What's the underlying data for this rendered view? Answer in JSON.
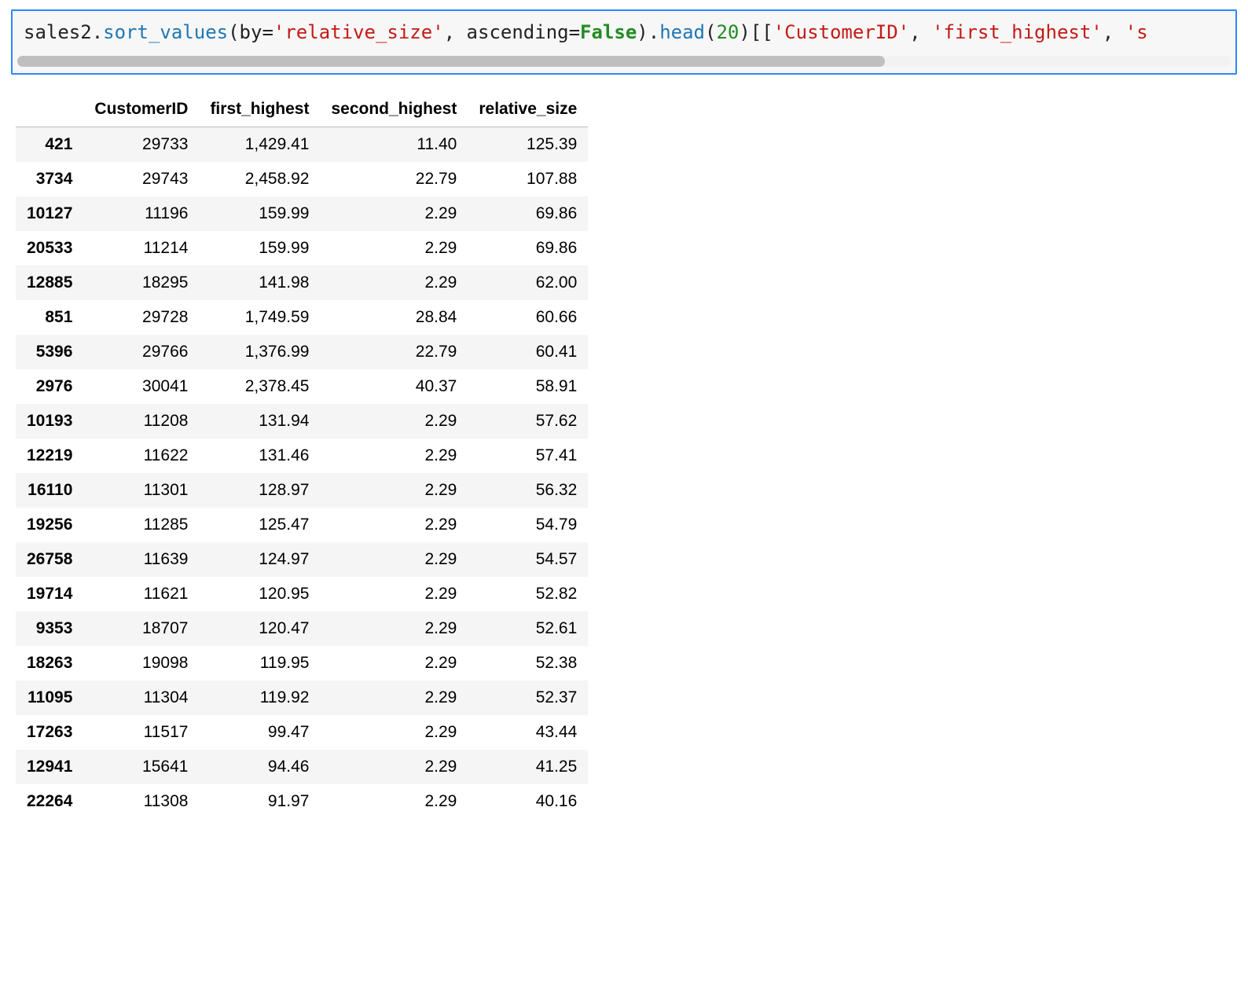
{
  "code": {
    "t1": "sales2",
    "d1": ".",
    "m1": "sort_values",
    "p1": "(by=",
    "s1": "'relative_size'",
    "p2": ", ascending=",
    "k1": "False",
    "p3": ")",
    "d2": ".",
    "m2": "head",
    "p4": "(",
    "n1": "20",
    "p5": ")[[",
    "s2": "'CustomerID'",
    "p6": ", ",
    "s3": "'first_highest'",
    "p7": ", ",
    "s4": "'s"
  },
  "table": {
    "columns": [
      "CustomerID",
      "first_highest",
      "second_highest",
      "relative_size"
    ],
    "rows": [
      {
        "idx": "421",
        "CustomerID": "29733",
        "first_highest": "1,429.41",
        "second_highest": "11.40",
        "relative_size": "125.39"
      },
      {
        "idx": "3734",
        "CustomerID": "29743",
        "first_highest": "2,458.92",
        "second_highest": "22.79",
        "relative_size": "107.88"
      },
      {
        "idx": "10127",
        "CustomerID": "11196",
        "first_highest": "159.99",
        "second_highest": "2.29",
        "relative_size": "69.86"
      },
      {
        "idx": "20533",
        "CustomerID": "11214",
        "first_highest": "159.99",
        "second_highest": "2.29",
        "relative_size": "69.86"
      },
      {
        "idx": "12885",
        "CustomerID": "18295",
        "first_highest": "141.98",
        "second_highest": "2.29",
        "relative_size": "62.00"
      },
      {
        "idx": "851",
        "CustomerID": "29728",
        "first_highest": "1,749.59",
        "second_highest": "28.84",
        "relative_size": "60.66"
      },
      {
        "idx": "5396",
        "CustomerID": "29766",
        "first_highest": "1,376.99",
        "second_highest": "22.79",
        "relative_size": "60.41"
      },
      {
        "idx": "2976",
        "CustomerID": "30041",
        "first_highest": "2,378.45",
        "second_highest": "40.37",
        "relative_size": "58.91"
      },
      {
        "idx": "10193",
        "CustomerID": "11208",
        "first_highest": "131.94",
        "second_highest": "2.29",
        "relative_size": "57.62"
      },
      {
        "idx": "12219",
        "CustomerID": "11622",
        "first_highest": "131.46",
        "second_highest": "2.29",
        "relative_size": "57.41"
      },
      {
        "idx": "16110",
        "CustomerID": "11301",
        "first_highest": "128.97",
        "second_highest": "2.29",
        "relative_size": "56.32"
      },
      {
        "idx": "19256",
        "CustomerID": "11285",
        "first_highest": "125.47",
        "second_highest": "2.29",
        "relative_size": "54.79"
      },
      {
        "idx": "26758",
        "CustomerID": "11639",
        "first_highest": "124.97",
        "second_highest": "2.29",
        "relative_size": "54.57"
      },
      {
        "idx": "19714",
        "CustomerID": "11621",
        "first_highest": "120.95",
        "second_highest": "2.29",
        "relative_size": "52.82"
      },
      {
        "idx": "9353",
        "CustomerID": "18707",
        "first_highest": "120.47",
        "second_highest": "2.29",
        "relative_size": "52.61"
      },
      {
        "idx": "18263",
        "CustomerID": "19098",
        "first_highest": "119.95",
        "second_highest": "2.29",
        "relative_size": "52.38"
      },
      {
        "idx": "11095",
        "CustomerID": "11304",
        "first_highest": "119.92",
        "second_highest": "2.29",
        "relative_size": "52.37"
      },
      {
        "idx": "17263",
        "CustomerID": "11517",
        "first_highest": "99.47",
        "second_highest": "2.29",
        "relative_size": "43.44"
      },
      {
        "idx": "12941",
        "CustomerID": "15641",
        "first_highest": "94.46",
        "second_highest": "2.29",
        "relative_size": "41.25"
      },
      {
        "idx": "22264",
        "CustomerID": "11308",
        "first_highest": "91.97",
        "second_highest": "2.29",
        "relative_size": "40.16"
      }
    ]
  }
}
